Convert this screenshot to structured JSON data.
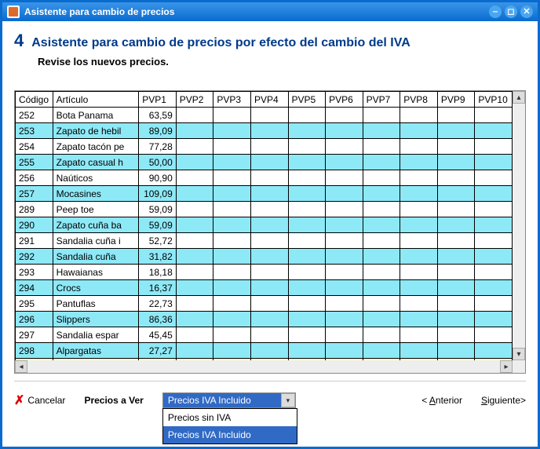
{
  "window": {
    "title": "Asistente para cambio de precios"
  },
  "step": {
    "number": "4",
    "title": "Asistente para cambio de precios por efecto del cambio del IVA",
    "subtitle": "Revise los nuevos precios."
  },
  "grid": {
    "headers": [
      "Código",
      "Artículo",
      "PVP1",
      "PVP2",
      "PVP3",
      "PVP4",
      "PVP5",
      "PVP6",
      "PVP7",
      "PVP8",
      "PVP9",
      "PVP10"
    ],
    "rows": [
      {
        "codigo": "252",
        "articulo": "Bota Panama",
        "pvp1": "63,59",
        "alt": false
      },
      {
        "codigo": "253",
        "articulo": "Zapato de hebil",
        "pvp1": "89,09",
        "alt": true
      },
      {
        "codigo": "254",
        "articulo": "Zapato tacón pe",
        "pvp1": "77,28",
        "alt": false
      },
      {
        "codigo": "255",
        "articulo": "Zapato casual h",
        "pvp1": "50,00",
        "alt": true
      },
      {
        "codigo": "256",
        "articulo": "Naúticos",
        "pvp1": "90,90",
        "alt": false
      },
      {
        "codigo": "257",
        "articulo": "Mocasines",
        "pvp1": "109,09",
        "alt": true
      },
      {
        "codigo": "289",
        "articulo": "Peep toe",
        "pvp1": "59,09",
        "alt": false
      },
      {
        "codigo": "290",
        "articulo": "Zapato cuña ba",
        "pvp1": "59,09",
        "alt": true
      },
      {
        "codigo": "291",
        "articulo": "Sandalia cuña i",
        "pvp1": "52,72",
        "alt": false
      },
      {
        "codigo": "292",
        "articulo": "Sandalia cuña",
        "pvp1": "31,82",
        "alt": true
      },
      {
        "codigo": "293",
        "articulo": "Hawaianas",
        "pvp1": "18,18",
        "alt": false
      },
      {
        "codigo": "294",
        "articulo": "Crocs",
        "pvp1": "16,37",
        "alt": true
      },
      {
        "codigo": "295",
        "articulo": "Pantuflas",
        "pvp1": "22,73",
        "alt": false
      },
      {
        "codigo": "296",
        "articulo": "Slippers",
        "pvp1": "86,36",
        "alt": true
      },
      {
        "codigo": "297",
        "articulo": "Sandalia espar",
        "pvp1": "45,45",
        "alt": false
      },
      {
        "codigo": "298",
        "articulo": "Alpargatas",
        "pvp1": "27,27",
        "alt": true
      }
    ]
  },
  "footer": {
    "cancel": "Cancelar",
    "precios_a_ver": "Precios a Ver",
    "combo_selected": "Precios IVA Incluido",
    "combo_options": [
      "Precios sin IVA",
      "Precios IVA Incluido"
    ],
    "anterior_prefix": "< ",
    "anterior_u": "A",
    "anterior_rest": "nterior",
    "siguiente_u": "S",
    "siguiente_rest": "iguiente>"
  }
}
